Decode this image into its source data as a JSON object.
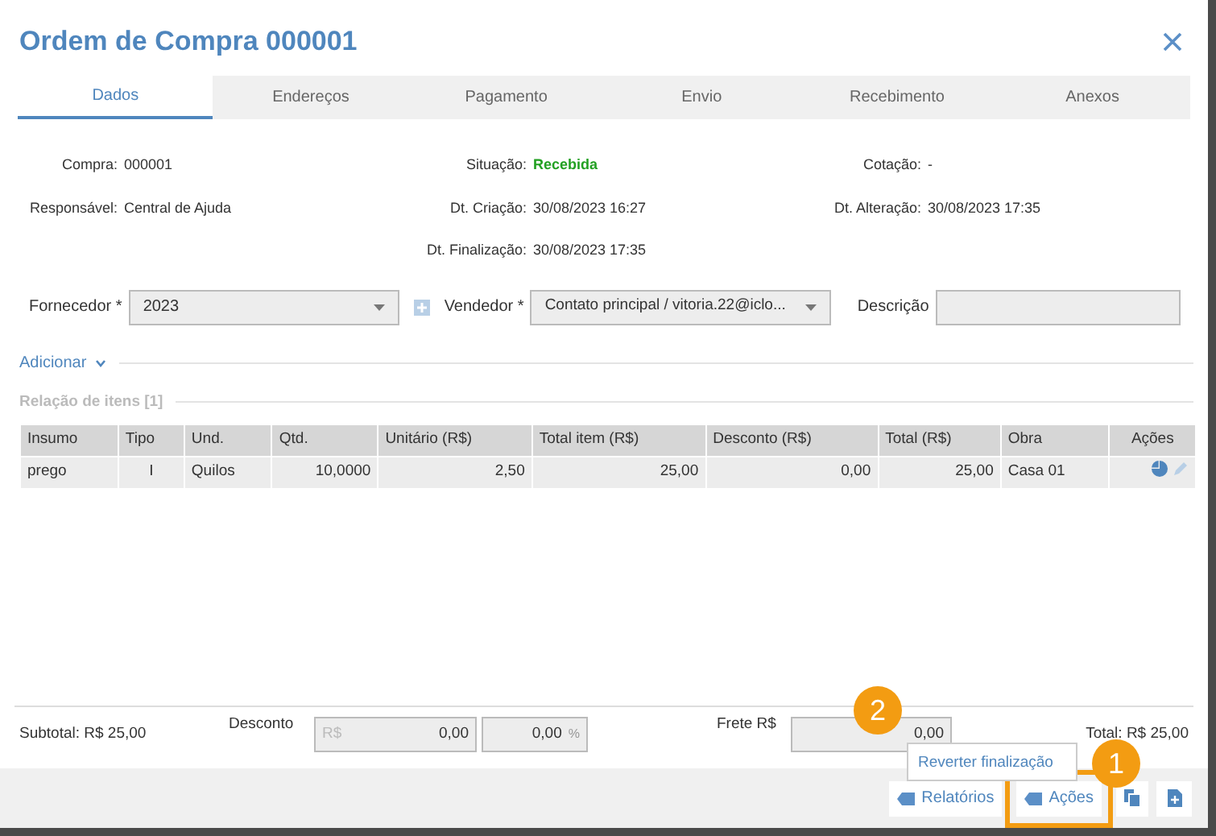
{
  "window": {
    "title": "Ordem de Compra 000001"
  },
  "tabs": [
    {
      "label": "Dados",
      "selected": true
    },
    {
      "label": "Endereços",
      "selected": false
    },
    {
      "label": "Pagamento",
      "selected": false
    },
    {
      "label": "Envio",
      "selected": false
    },
    {
      "label": "Recebimento",
      "selected": false
    },
    {
      "label": "Anexos",
      "selected": false
    }
  ],
  "info": [
    [
      {
        "label": "Compra:",
        "value": "000001",
        "kind": "plain"
      },
      {
        "label": "Situação:",
        "value": "Recebida",
        "kind": "status"
      },
      {
        "label": "Cotação:",
        "value": "-",
        "kind": "plain"
      }
    ],
    [
      {
        "label": "Responsável:",
        "value": "Central de Ajuda",
        "kind": "plain"
      },
      {
        "label": "Dt. Criação:",
        "value": "30/08/2023 16:27",
        "kind": "plain"
      },
      {
        "label": "Dt. Alteração:",
        "value": "30/08/2023 17:35",
        "kind": "plain"
      }
    ],
    [
      {
        "label": "Dt. Finalização:",
        "value": "30/08/2023 17:35",
        "kind": "plain"
      }
    ]
  ],
  "form": {
    "supplier": {
      "label": "Fornecedor *",
      "value": "2023"
    },
    "seller": {
      "label": "Vendedor *",
      "value": "Contato principal / vitoria.22@iclo..."
    },
    "description": {
      "label": "Descrição"
    }
  },
  "add_link": "Adicionar",
  "items_title": "Relação de itens [1]",
  "table": {
    "columns": [
      "Insumo",
      "Tipo",
      "Und.",
      "Qtd.",
      "Unitário (R$)",
      "Total item (R$)",
      "Desconto (R$)",
      "Total (R$)",
      "Obra",
      "Ações"
    ],
    "rows": [
      [
        "prego",
        "I",
        "Quilos",
        "10,0000",
        "2,50",
        "25,00",
        "0,00",
        "25,00",
        "Casa 01"
      ]
    ]
  },
  "totals": {
    "subtotal": "Subtotal: R$ 25,00",
    "discount_label": "Desconto",
    "discount_prefix": "R$",
    "discount_value": "0,00",
    "percent_value": "0,00",
    "percent_suffix": "%",
    "freight_label": "Frete R$",
    "freight_value": "0,00",
    "total": "Total: R$ 25,00"
  },
  "menu": {
    "items": [
      "Reverter finalização"
    ]
  },
  "footer": {
    "buttons": [
      "Relatórios",
      "Ações"
    ]
  },
  "annotations": [
    {
      "label": "1"
    },
    {
      "label": "2"
    }
  ]
}
